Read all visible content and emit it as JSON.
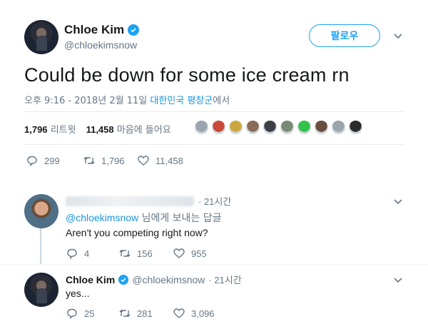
{
  "tweet": {
    "author_name": "Chloe Kim",
    "author_handle": "@chloekimsnow",
    "follow_label": "팔로우",
    "text": "Could be down for some ice cream rn",
    "time": "오후 9:16 - 2018년 2월 11일",
    "location": "대한민국 평창군",
    "location_suffix": "에서",
    "retweets_count": "1,796",
    "retweets_label": "리트윗",
    "likes_count": "11,458",
    "likes_label": "마음에 들어요",
    "replies": "299",
    "retweets": "1,796",
    "likes": "11,458"
  },
  "likers": [
    {
      "color": "#9aa5ae"
    },
    {
      "color": "#c8483a"
    },
    {
      "color": "#c9a640"
    },
    {
      "color": "#8a6b56"
    },
    {
      "color": "#3d3f46"
    },
    {
      "color": "#7b8a74"
    },
    {
      "color": "#33c24a"
    },
    {
      "color": "#6a4e42"
    },
    {
      "color": "#9aa5ae"
    },
    {
      "color": "#2c2c2c"
    }
  ],
  "reply1": {
    "time": "· 21시간",
    "mention": "@chloekimsnow",
    "reply_to_suffix": " 님에게 보내는 답글",
    "text": "Aren't you competing right now?",
    "replies": "4",
    "retweets": "156",
    "likes": "955"
  },
  "reply2": {
    "author_name": "Chloe Kim",
    "author_handle": "@chloekimsnow",
    "time": "· 21시간",
    "text": "yes...",
    "replies": "25",
    "retweets": "281",
    "likes": "3,096"
  },
  "colors": {
    "accent": "#1da1f2",
    "link": "#1b95e0",
    "muted": "#657786",
    "reply_bg": "#f5f8fa"
  }
}
